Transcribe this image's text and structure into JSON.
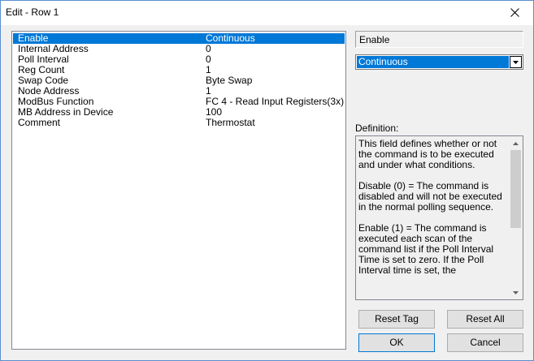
{
  "window": {
    "title": "Edit - Row 1"
  },
  "properties": [
    {
      "name": "Enable",
      "value": "Continuous"
    },
    {
      "name": "Internal Address",
      "value": "0"
    },
    {
      "name": "Poll Interval",
      "value": "0"
    },
    {
      "name": "Reg Count",
      "value": "1"
    },
    {
      "name": "Swap Code",
      "value": "Byte Swap"
    },
    {
      "name": "Node Address",
      "value": "1"
    },
    {
      "name": "ModBus Function",
      "value": "FC 4 - Read Input Registers(3x)"
    },
    {
      "name": "MB Address in Device",
      "value": "100"
    },
    {
      "name": "Comment",
      "value": "Thermostat"
    }
  ],
  "selected_field": {
    "label": "Enable",
    "value": "Continuous"
  },
  "definition": {
    "label": "Definition:",
    "text": "This field defines whether or not the command is to be executed and under what conditions.\n\nDisable (0) = The command is disabled and will not be executed in the normal polling sequence.\n\nEnable (1) = The command is executed each scan of the command list if the Poll Interval Time is set to zero. If the Poll Interval time is set, the"
  },
  "buttons": {
    "reset_tag": "Reset Tag",
    "reset_all": "Reset All",
    "ok": "OK",
    "cancel": "Cancel"
  },
  "colors": {
    "selection": "#0078d7",
    "window_border": "#5a8fcf"
  },
  "icons": {
    "close": "close-icon",
    "dropdown": "chevron-down-icon",
    "scroll_up": "scroll-up-icon",
    "scroll_down": "scroll-down-icon"
  }
}
